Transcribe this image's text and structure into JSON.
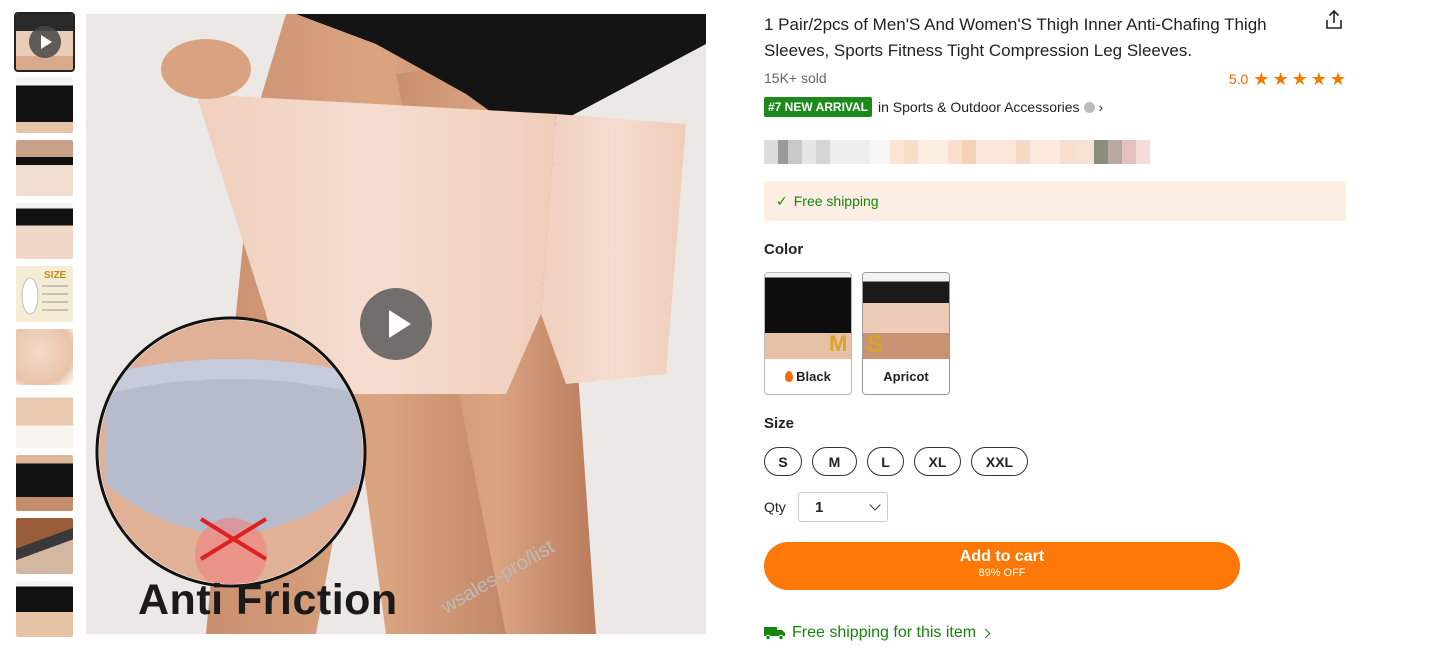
{
  "product": {
    "title": "1 Pair/2pcs of Men'S And Women'S Thigh Inner Anti-Chafing Thigh Sleeves, Sports Fitness Tight Compression Leg Sleeves.",
    "sold": "15K+ sold",
    "rating": "5.0",
    "rating_stars": 5,
    "rank_badge": "#7 NEW ARRIVAL",
    "rank_category": "in Sports & Outdoor Accessories"
  },
  "gallery": {
    "caption": "Anti Friction",
    "watermark": "wsales-pro/list"
  },
  "shipping_banner": "Free shipping",
  "color": {
    "label": "Color",
    "options": [
      {
        "name": "Black",
        "size_mark": "M"
      },
      {
        "name": "Apricot",
        "size_mark": "S"
      }
    ]
  },
  "size": {
    "label": "Size",
    "options": [
      "S",
      "M",
      "L",
      "XL",
      "XXL"
    ]
  },
  "qty": {
    "label": "Qty",
    "value": "1"
  },
  "cart": {
    "label": "Add to cart",
    "discount": "89% OFF"
  },
  "free_shipping_link": "Free shipping for this item",
  "colors": {
    "accent_orange": "#fd7806",
    "green": "#17840f",
    "star": "#f47b00"
  }
}
